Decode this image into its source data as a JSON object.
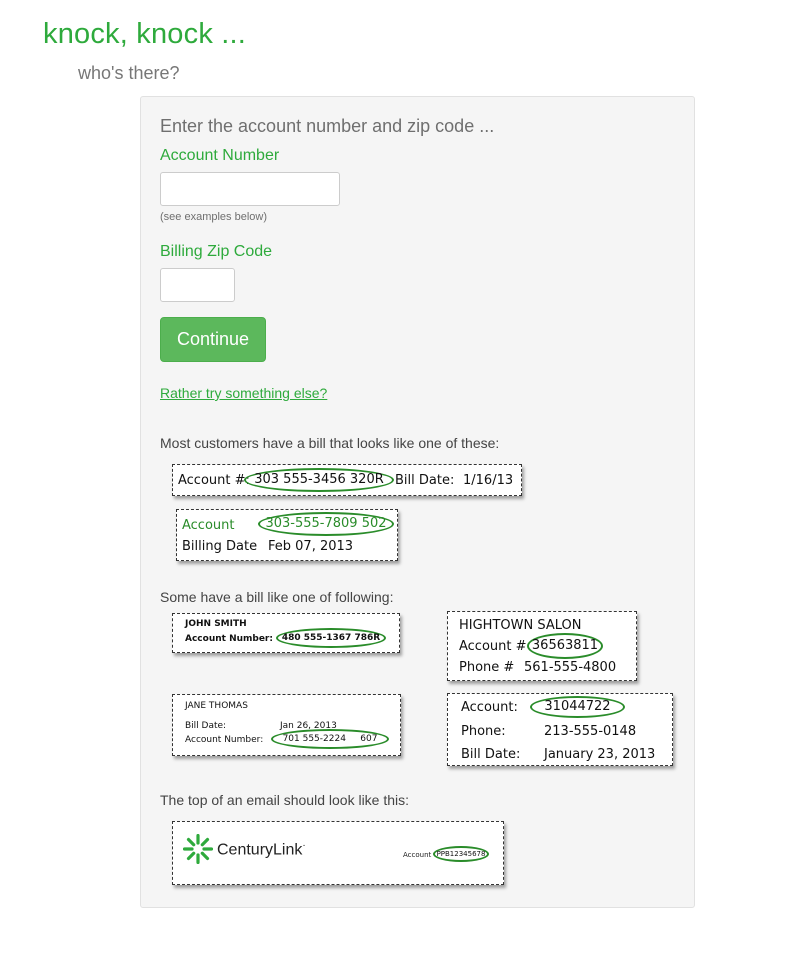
{
  "header": {
    "title": "knock, knock ...",
    "subtitle": "who's there?"
  },
  "form": {
    "prompt": "Enter the account number and zip code ...",
    "account_label": "Account Number",
    "account_value": "",
    "account_help": "(see examples below)",
    "zip_label": "Billing Zip Code",
    "zip_value": "",
    "continue_label": "Continue",
    "alt_link": "Rather try something else?"
  },
  "examples": {
    "intro_most": "Most customers have a bill that looks like one of these:",
    "bill1": {
      "account_label": "Account #:",
      "account_number": "303 555-3456 320R",
      "date_label": "Bill Date:",
      "date": "1/16/13"
    },
    "bill2": {
      "account_label": "Account",
      "account_number": "303-555-7809 502",
      "date_label": "Billing Date",
      "date": "Feb 07, 2013"
    },
    "intro_some": "Some have a bill like one of following:",
    "bill3": {
      "name": "JOHN SMITH",
      "account_label": "Account Number:",
      "account_number": "480 555-1367 786R"
    },
    "bill4": {
      "name": "HIGHTOWN SALON",
      "account_label": "Account #",
      "account_number": "36563811",
      "phone_label": "Phone #",
      "phone": "561-555-4800"
    },
    "bill5": {
      "name": "JANE THOMAS",
      "date_label": "Bill Date:",
      "date": "Jan 26, 2013",
      "account_label": "Account Number:",
      "account_number": "701 555-2224     607"
    },
    "bill6": {
      "account_label": "Account:",
      "account_number": "31044722",
      "phone_label": "Phone:",
      "phone": "213-555-0148",
      "date_label": "Bill Date:",
      "date": "January 23, 2013"
    },
    "intro_email": "The top of an email should look like this:",
    "email": {
      "brand": "CenturyLink",
      "brand_mark": "·",
      "account_label": "Account",
      "account_number": "PPB12345678",
      "brand_color": "#2eaa3c"
    }
  }
}
